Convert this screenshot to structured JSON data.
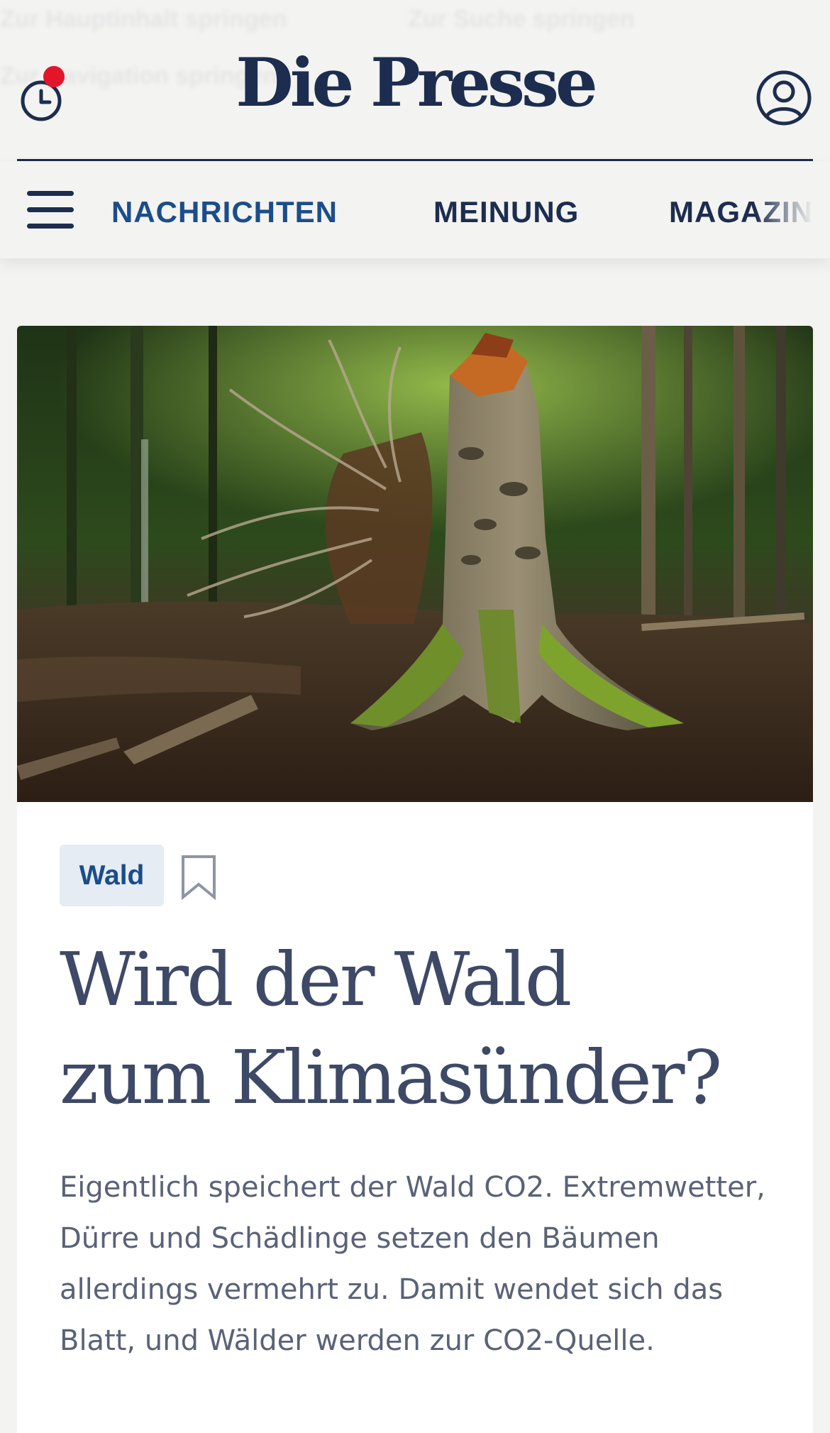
{
  "skip_links": [
    "Zur Hauptinhalt springen",
    "Zur Suche springen",
    "Zur Navigation springen"
  ],
  "header": {
    "logo": "Die Presse",
    "history_icon": "clock-icon",
    "notification_dot_color": "#e3152b",
    "account_icon": "user-icon"
  },
  "nav": {
    "menu_icon": "hamburger-menu-icon",
    "items": [
      "NACHRICHTEN",
      "MEINUNG",
      "MAGAZIN"
    ],
    "active_index": 0
  },
  "article": {
    "image_alt": "Umgestürzter, abgebrochener Baumstamm mit Baumpilzen im Wald",
    "tag": "Wald",
    "bookmark_icon": "bookmark-icon",
    "headline_lines": [
      "Wird der Wald",
      "zum Klimasünder?"
    ],
    "lead": "Eigentlich speichert der Wald CO2. Extremwetter, Dürre und Schädlinge setzen den Bäumen allerdings vermehrt zu. Damit wendet sich das Blatt, und Wälder werden zur CO2-Quelle."
  },
  "colors": {
    "brand_navy": "#1c2d4f",
    "accent_blue": "#1b4d8a",
    "tag_background": "#e6ecf3",
    "page_background": "#f3f3f1"
  }
}
